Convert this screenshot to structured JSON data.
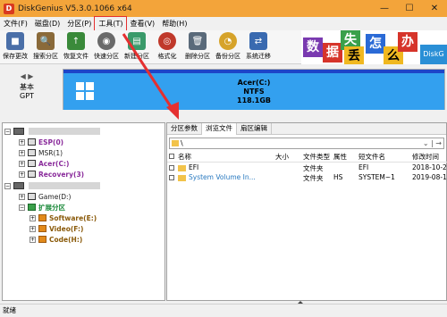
{
  "titlebar": {
    "title": "DiskGenius V5.3.0.1066 x64",
    "icon": "D"
  },
  "menu": [
    {
      "label": "文件(F)"
    },
    {
      "label": "磁盘(D)"
    },
    {
      "label": "分区(P)"
    },
    {
      "label": "工具(T)"
    },
    {
      "label": "查看(V)"
    },
    {
      "label": "帮助(H)"
    }
  ],
  "toolbar": [
    {
      "label": "保存更改",
      "icon": "save-icon",
      "color": "#4a6fa8"
    },
    {
      "label": "搜索分区",
      "icon": "search-icon",
      "color": "#8a6a3a"
    },
    {
      "label": "恢复文件",
      "icon": "recover-icon",
      "color": "#3a8a3a"
    },
    {
      "label": "快速分区",
      "icon": "quick-partition-icon",
      "color": "#6a6a6a"
    },
    {
      "label": "新建分区",
      "icon": "new-partition-icon",
      "color": "#3a9a6a"
    },
    {
      "label": "格式化",
      "icon": "format-icon",
      "color": "#c0392b"
    },
    {
      "label": "删除分区",
      "icon": "delete-icon",
      "color": "#5a6a7a"
    },
    {
      "label": "备份分区",
      "icon": "backup-icon",
      "color": "#d6a32a"
    },
    {
      "label": "系统迁移",
      "icon": "migrate-icon",
      "color": "#3a6ab0"
    }
  ],
  "banner": {
    "chars": [
      "数",
      "据",
      "失",
      "丢",
      "怎",
      "么",
      "办"
    ],
    "brand": "DiskG"
  },
  "disk": {
    "nav_label1": "基本",
    "nav_label2": "GPT",
    "partition_name": "Acer(C:)",
    "partition_fs": "NTFS",
    "partition_size": "118.1GB"
  },
  "tree": [
    {
      "label": "ESP(0)",
      "style": "purple"
    },
    {
      "label": "MSR(1)",
      "style": "dark"
    },
    {
      "label": "Acer(C:)",
      "style": "purple"
    },
    {
      "label": "Recovery(3)",
      "style": "purple"
    },
    {
      "label": "Game(D:)",
      "style": "dark"
    },
    {
      "label": "扩展分区",
      "style": "green"
    },
    {
      "label": "Software(E:)",
      "style": "brown"
    },
    {
      "label": "Video(F:)",
      "style": "brown"
    },
    {
      "label": "Code(H:)",
      "style": "brown"
    }
  ],
  "tabs": [
    "分区参数",
    "浏览文件",
    "扇区编辑"
  ],
  "path": "\\",
  "columns": {
    "name": "名称",
    "size": "大小",
    "type": "文件类型",
    "attr": "属性",
    "short": "短文件名",
    "modified": "修改时间"
  },
  "files": [
    {
      "name": "EFI",
      "size": "",
      "type": "文件夹",
      "attr": "",
      "short": "EFI",
      "modified": "2018-10-2"
    },
    {
      "name": "System Volume In...",
      "size": "",
      "type": "文件夹",
      "attr": "HS",
      "short": "SYSTEM~1",
      "modified": "2019-08-1"
    }
  ],
  "status": "就绪"
}
